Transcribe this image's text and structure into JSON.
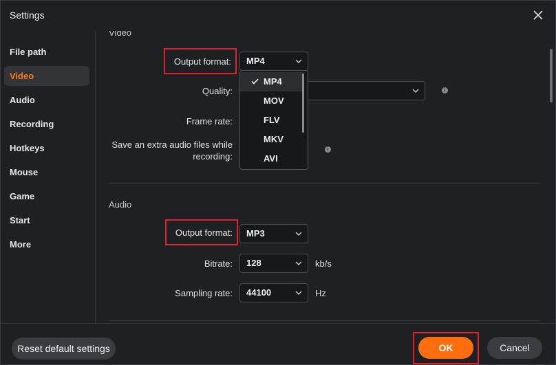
{
  "window": {
    "title": "Settings"
  },
  "sidebar": {
    "items": [
      {
        "label": "File path",
        "active": false
      },
      {
        "label": "Video",
        "active": true
      },
      {
        "label": "Audio",
        "active": false
      },
      {
        "label": "Recording",
        "active": false
      },
      {
        "label": "Hotkeys",
        "active": false
      },
      {
        "label": "Mouse",
        "active": false
      },
      {
        "label": "Game",
        "active": false
      },
      {
        "label": "Start",
        "active": false
      },
      {
        "label": "More",
        "active": false
      }
    ]
  },
  "video": {
    "section_title": "Video",
    "output_format": {
      "label": "Output format:",
      "value": "MP4"
    },
    "quality": {
      "label": "Quality:",
      "value": ""
    },
    "frame_rate": {
      "label": "Frame rate:"
    },
    "extra_audio": {
      "label_line1": "Save an extra audio files while",
      "label_line2": "recording:"
    },
    "format_options": [
      "MP4",
      "MOV",
      "FLV",
      "MKV",
      "AVI"
    ],
    "selected_option": "MP4"
  },
  "audio": {
    "section_title": "Audio",
    "output_format": {
      "label": "Output format:",
      "value": "MP3"
    },
    "bitrate": {
      "label": "Bitrate:",
      "value": "128",
      "unit": "kb/s"
    },
    "sampling_rate": {
      "label": "Sampling rate:",
      "value": "44100",
      "unit": "Hz"
    }
  },
  "footer": {
    "reset_label": "Reset default settings",
    "ok_label": "OK",
    "cancel_label": "Cancel"
  },
  "colors": {
    "accent": "#ff6e0e",
    "highlight_border": "#e0242b",
    "background": "#1f2024"
  }
}
